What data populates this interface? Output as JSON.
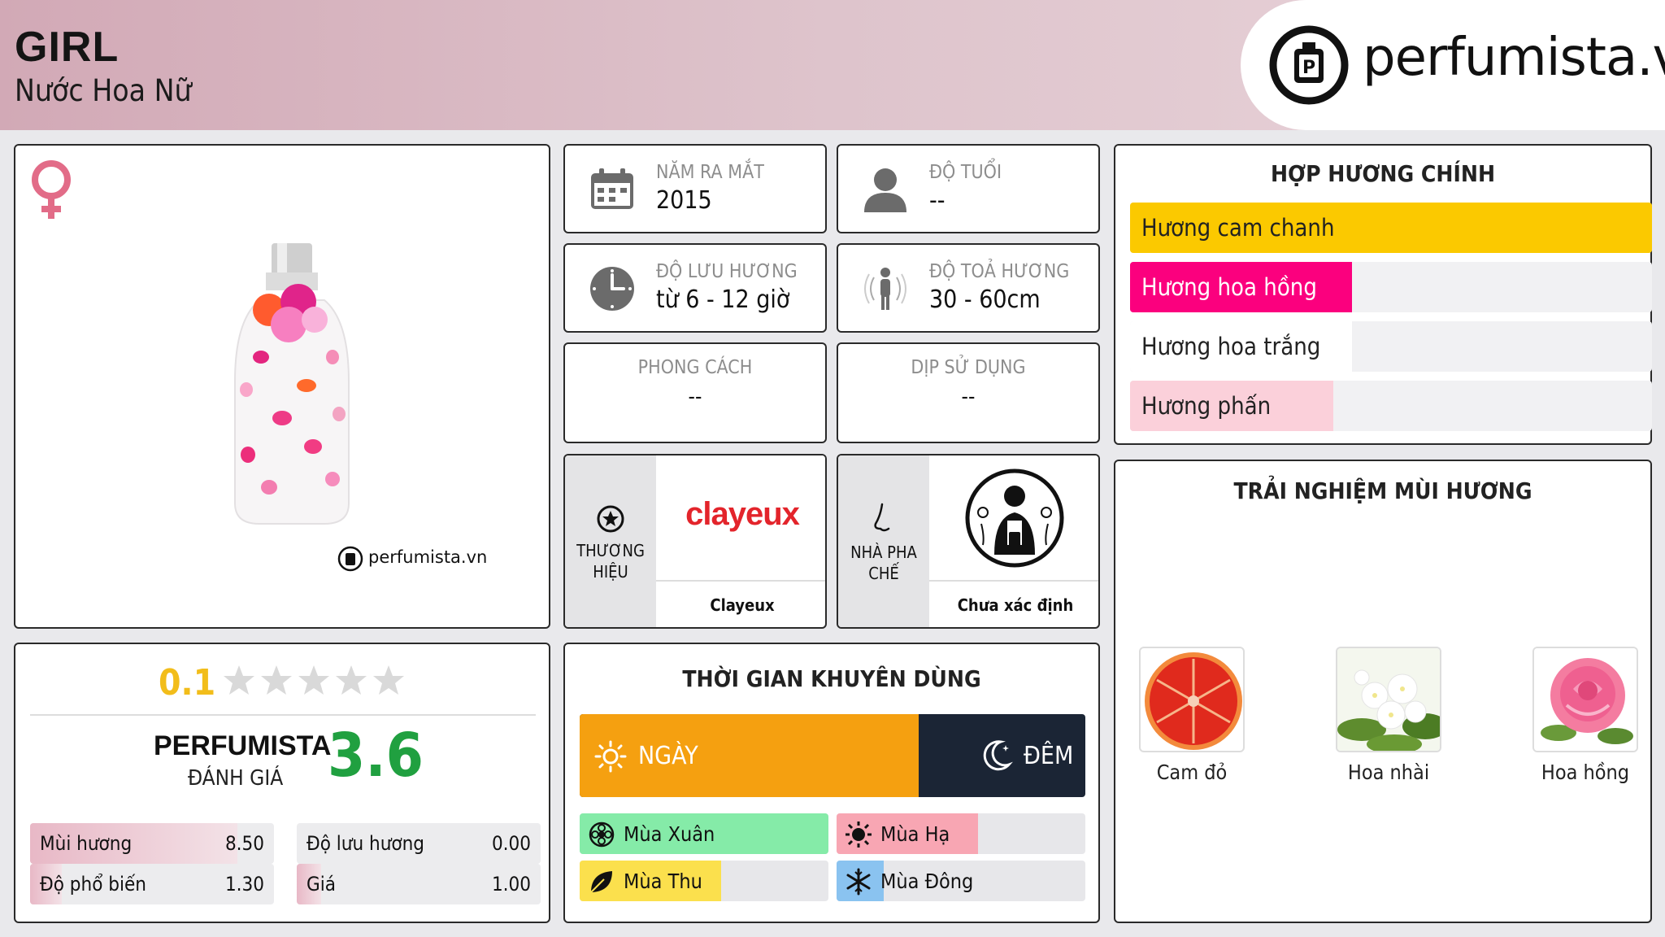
{
  "header": {
    "title": "GIRL",
    "subtitle": "Nước Hoa Nữ",
    "logo_text": "perfumista.vn"
  },
  "product": {
    "gender_icon": "female-icon",
    "watermark": "perfumista.vn"
  },
  "info": {
    "launch_label": "NĂM RA MẮT",
    "launch_value": "2015",
    "age_label": "ĐỘ TUỔI",
    "age_value": "--",
    "longevity_label": "ĐỘ LƯU HƯƠNG",
    "longevity_value": "từ 6 - 12 giờ",
    "sillage_label": "ĐỘ TOẢ HƯƠNG",
    "sillage_value": "30 - 60cm",
    "style_label": "PHONG CÁCH",
    "style_value": "--",
    "occasion_label": "DỊP SỬ DỤNG",
    "occasion_value": "--"
  },
  "brand": {
    "label_line1": "THƯƠNG",
    "label_line2": "HIỆU",
    "logo_text": "clayeux",
    "name": "Clayeux"
  },
  "perfumer": {
    "label_line1": "NHÀ PHA",
    "label_line2": "CHẾ",
    "name": "Chưa xác định"
  },
  "accords": {
    "title": "HỢP HƯƠNG CHÍNH",
    "items": [
      {
        "name": "Hương cam chanh",
        "level": 1.0,
        "color": "#fbc900"
      },
      {
        "name": "Hương hoa hồng",
        "level": 0.425,
        "color": "#fb007e"
      },
      {
        "name": "Hương hoa trắng",
        "level": 0.425,
        "color": "#ffffff"
      },
      {
        "name": "Hương phấn",
        "level": 0.39,
        "color": "#fbd0da"
      }
    ]
  },
  "notes": {
    "title": "TRẢI NGHIỆM MÙI HƯƠNG",
    "items": [
      {
        "name": "Cam đỏ"
      },
      {
        "name": "Hoa nhài"
      },
      {
        "name": "Hoa hồng"
      }
    ]
  },
  "rating": {
    "user_score": "0.1",
    "stars": 0.02,
    "brand_label": "PERFUMISTA",
    "brand_sub": "ĐÁNH GIÁ",
    "brand_score": "3.6",
    "metrics": [
      {
        "name": "Mùi hương",
        "value": "8.50",
        "level": 0.85
      },
      {
        "name": "Độ lưu hương",
        "value": "0.00",
        "level": 0.0
      },
      {
        "name": "Độ phổ biến",
        "value": "1.30",
        "level": 0.13
      },
      {
        "name": "Giá",
        "value": "1.00",
        "level": 0.1
      }
    ]
  },
  "time": {
    "title": "THỜI GIAN KHUYÊN DÙNG",
    "day_label": "NGÀY",
    "night_label": "ĐÊM",
    "day_share": 0.67,
    "day_color": "#f5a010",
    "night_color": "#1b2535",
    "seasons": [
      {
        "name": "Mùa Xuân",
        "level": 1.0,
        "color": "#85eba8",
        "icon": "flower-icon"
      },
      {
        "name": "Mùa Hạ",
        "level": 0.57,
        "color": "#f8a6b3",
        "icon": "sun-icon"
      },
      {
        "name": "Mùa Thu",
        "level": 0.57,
        "color": "#fbe04d",
        "icon": "leaf-icon"
      },
      {
        "name": "Mùa Đông",
        "level": 0.19,
        "color": "#8ac3f0",
        "icon": "snowflake-icon"
      }
    ]
  }
}
